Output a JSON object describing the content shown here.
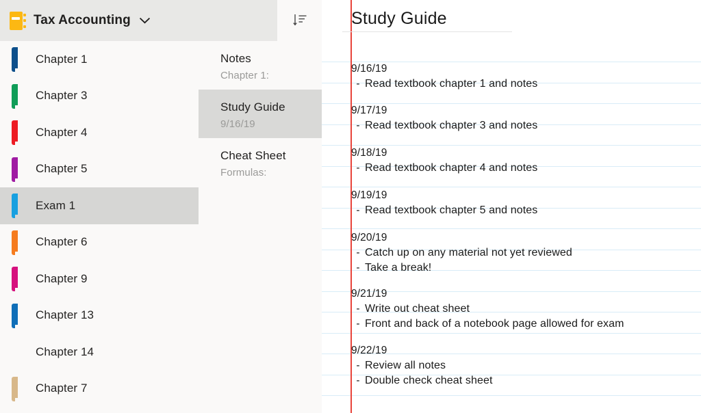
{
  "header": {
    "notebook_icon": "notebook-icon",
    "notebook_title": "Tax Accounting",
    "dropdown_icon": "chevron-down-icon",
    "sort_icon": "sort-descending-icon"
  },
  "sidebar": {
    "items": [
      {
        "label": "Chapter 1",
        "color": "#0d4f8b",
        "selected": false
      },
      {
        "label": "Chapter 3",
        "color": "#0f9d58",
        "selected": false
      },
      {
        "label": "Chapter 4",
        "color": "#ed1c24",
        "selected": false
      },
      {
        "label": "Chapter 5",
        "color": "#a01ba3",
        "selected": false
      },
      {
        "label": "Exam 1",
        "color": "#18a0e0",
        "selected": true
      },
      {
        "label": "Chapter 6",
        "color": "#f57c1f",
        "selected": false
      },
      {
        "label": "Chapter 9",
        "color": "#d6117e",
        "selected": false
      },
      {
        "label": "Chapter 13",
        "color": "#0f6fb8",
        "selected": false
      },
      {
        "label": "Chapter 14",
        "color": "#5b২1a0",
        "selected": false
      },
      {
        "label": "Chapter 7",
        "color": "#d8b88a",
        "selected": false
      }
    ]
  },
  "pagelist": {
    "pages": [
      {
        "title": "Notes",
        "subtitle": "Chapter 1:",
        "selected": false
      },
      {
        "title": "Study Guide",
        "subtitle": "9/16/19",
        "selected": true
      },
      {
        "title": "Cheat Sheet",
        "subtitle": "Formulas:",
        "selected": false
      }
    ]
  },
  "content": {
    "title": "Study Guide",
    "margin_color": "#e8433a",
    "rule_color": "#d8ecf7",
    "entries": [
      {
        "date": "9/16/19",
        "bullets": [
          "Read textbook chapter 1 and notes"
        ]
      },
      {
        "date": "9/17/19",
        "bullets": [
          "Read textbook chapter 3 and notes"
        ]
      },
      {
        "date": "9/18/19",
        "bullets": [
          "Read textbook chapter 4 and notes"
        ]
      },
      {
        "date": "9/19/19",
        "bullets": [
          "Read textbook chapter 5 and notes"
        ]
      },
      {
        "date": "9/20/19",
        "bullets": [
          "Catch up on any material not yet reviewed",
          "Take a break!"
        ]
      },
      {
        "date": "9/21/19",
        "bullets": [
          "Write out cheat sheet",
          "Front and back of a notebook page allowed for exam"
        ]
      },
      {
        "date": "9/22/19",
        "bullets": [
          "Review all notes",
          "Double check cheat sheet"
        ]
      }
    ],
    "bullet_dash": "-"
  }
}
